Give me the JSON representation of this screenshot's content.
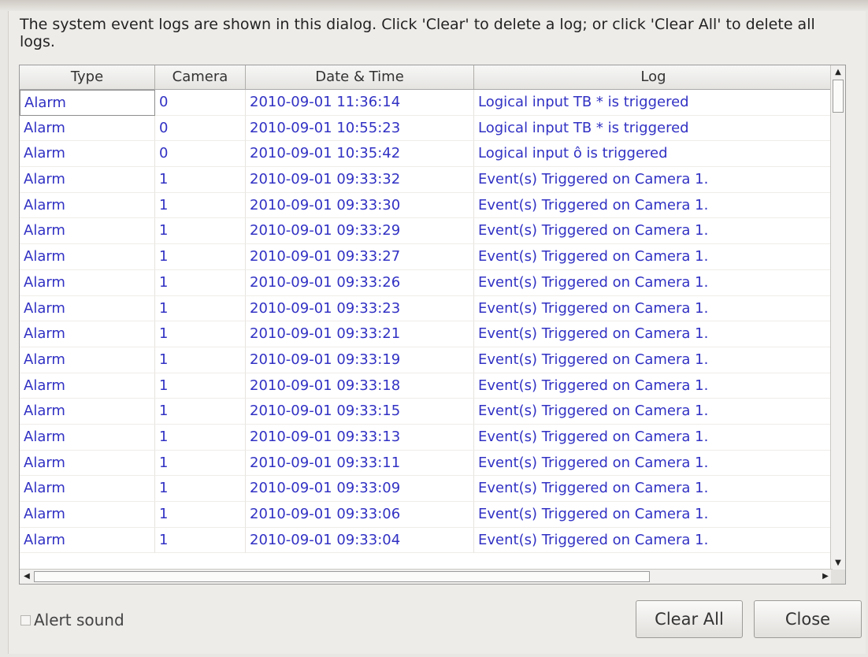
{
  "description": "The system event logs are shown in this dialog. Click 'Clear' to delete a log; or click 'Clear All' to delete all logs.",
  "table": {
    "columns": [
      "Type",
      "Camera",
      "Date & Time",
      "Log"
    ],
    "rows": [
      [
        "Alarm",
        "0",
        "2010-09-01 11:36:14",
        "Logical input TB     *     is triggered"
      ],
      [
        "Alarm",
        "0",
        "2010-09-01 10:55:23",
        "Logical input TB     *     is triggered"
      ],
      [
        "Alarm",
        "0",
        "2010-09-01 10:35:42",
        "Logical input ô is triggered"
      ],
      [
        "Alarm",
        "1",
        "2010-09-01 09:33:32",
        "Event(s) Triggered on Camera 1."
      ],
      [
        "Alarm",
        "1",
        "2010-09-01 09:33:30",
        "Event(s) Triggered on Camera 1."
      ],
      [
        "Alarm",
        "1",
        "2010-09-01 09:33:29",
        "Event(s) Triggered on Camera 1."
      ],
      [
        "Alarm",
        "1",
        "2010-09-01 09:33:27",
        "Event(s) Triggered on Camera 1."
      ],
      [
        "Alarm",
        "1",
        "2010-09-01 09:33:26",
        "Event(s) Triggered on Camera 1."
      ],
      [
        "Alarm",
        "1",
        "2010-09-01 09:33:23",
        "Event(s) Triggered on Camera 1."
      ],
      [
        "Alarm",
        "1",
        "2010-09-01 09:33:21",
        "Event(s) Triggered on Camera 1."
      ],
      [
        "Alarm",
        "1",
        "2010-09-01 09:33:19",
        "Event(s) Triggered on Camera 1."
      ],
      [
        "Alarm",
        "1",
        "2010-09-01 09:33:18",
        "Event(s) Triggered on Camera 1."
      ],
      [
        "Alarm",
        "1",
        "2010-09-01 09:33:15",
        "Event(s) Triggered on Camera 1."
      ],
      [
        "Alarm",
        "1",
        "2010-09-01 09:33:13",
        "Event(s) Triggered on Camera 1."
      ],
      [
        "Alarm",
        "1",
        "2010-09-01 09:33:11",
        "Event(s) Triggered on Camera 1."
      ],
      [
        "Alarm",
        "1",
        "2010-09-01 09:33:09",
        "Event(s) Triggered on Camera 1."
      ],
      [
        "Alarm",
        "1",
        "2010-09-01 09:33:06",
        "Event(s) Triggered on Camera 1."
      ],
      [
        "Alarm",
        "1",
        "2010-09-01 09:33:04",
        "Event(s) Triggered on Camera 1."
      ]
    ]
  },
  "alert_sound": {
    "label": "Alert sound",
    "checked": false
  },
  "buttons": {
    "clear_all": "Clear All",
    "close": "Close"
  },
  "colors": {
    "row_text": "#3131c4"
  }
}
